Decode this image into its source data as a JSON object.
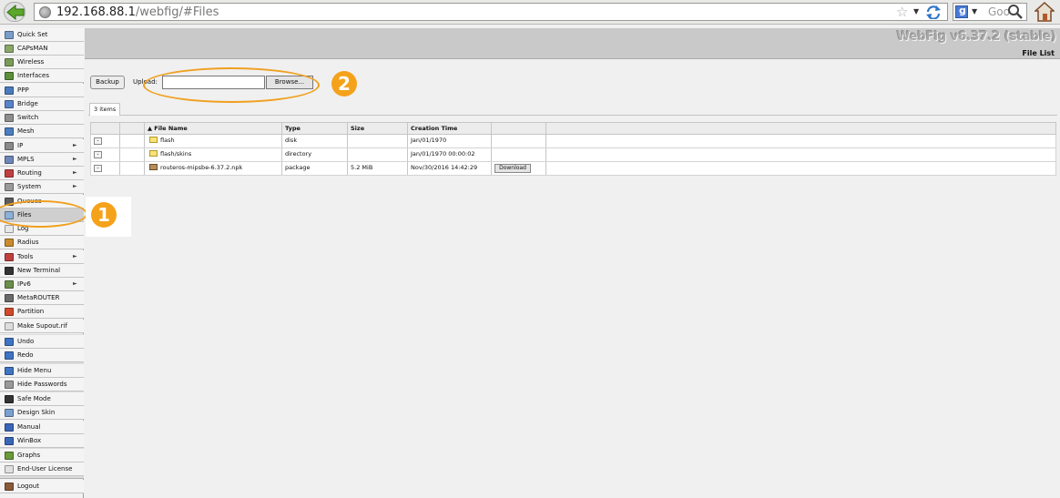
{
  "browser": {
    "url_host": "192.168.88.1",
    "url_path": "/webfig/#Files",
    "search_placeholder": "Goo"
  },
  "header": {
    "brand": "WebFig v6.37.2 (stable)",
    "page_title": "File List"
  },
  "sidebar": {
    "items": [
      {
        "label": "Quick Set",
        "icon": "quick-set-icon",
        "color": "#7a9ec9"
      },
      {
        "label": "CAPsMAN",
        "icon": "capsman-icon",
        "color": "#8aa76a"
      },
      {
        "label": "Wireless",
        "icon": "wireless-icon",
        "color": "#7a9b58"
      },
      {
        "label": "Interfaces",
        "icon": "interfaces-icon",
        "color": "#5b8f3a"
      },
      {
        "label": "PPP",
        "icon": "ppp-icon",
        "color": "#4a7bbd"
      },
      {
        "label": "Bridge",
        "icon": "bridge-icon",
        "color": "#5a83c8"
      },
      {
        "label": "Switch",
        "icon": "switch-icon",
        "color": "#8e8e8e"
      },
      {
        "label": "Mesh",
        "icon": "mesh-icon",
        "color": "#4b7dc0"
      },
      {
        "label": "IP",
        "icon": "ip-icon",
        "color": "#8a8a8a"
      },
      {
        "label": "MPLS",
        "icon": "mpls-icon",
        "color": "#6f86b8"
      },
      {
        "label": "Routing",
        "icon": "routing-icon",
        "color": "#c04040"
      },
      {
        "label": "System",
        "icon": "system-icon",
        "color": "#9a9a9a"
      },
      {
        "label": "Queues",
        "icon": "queues-icon",
        "color": "#5c5c5c"
      },
      {
        "label": "Files",
        "icon": "files-folder-icon",
        "color": "#8db0d6"
      },
      {
        "label": "Log",
        "icon": "log-icon",
        "color": "#e8e8e8"
      },
      {
        "label": "Radius",
        "icon": "radius-icon",
        "color": "#c98a30"
      },
      {
        "label": "Tools",
        "icon": "tools-icon",
        "color": "#c04040"
      },
      {
        "label": "New Terminal",
        "icon": "terminal-icon",
        "color": "#333333"
      },
      {
        "label": "IPv6",
        "icon": "ipv6-icon",
        "color": "#6a8f4a"
      },
      {
        "label": "MetaROUTER",
        "icon": "metarouter-icon",
        "color": "#6a6a6a"
      },
      {
        "label": "Partition",
        "icon": "partition-icon",
        "color": "#d04a2a"
      },
      {
        "label": "Make Supout.rif",
        "icon": "supout-icon",
        "color": "#dddddd"
      },
      {
        "label": "Undo",
        "icon": "undo-icon",
        "color": "#3f74c4"
      },
      {
        "label": "Redo",
        "icon": "redo-icon",
        "color": "#3f74c4"
      },
      {
        "label": "Hide Menu",
        "icon": "hide-menu-icon",
        "color": "#3f74c4"
      },
      {
        "label": "Hide Passwords",
        "icon": "hide-passwords-icon",
        "color": "#9a9a9a"
      },
      {
        "label": "Safe Mode",
        "icon": "umbrella-icon",
        "color": "#333333"
      },
      {
        "label": "Design Skin",
        "icon": "design-skin-icon",
        "color": "#7aa0cf"
      },
      {
        "label": "Manual",
        "icon": "manual-icon",
        "color": "#3a66b8"
      },
      {
        "label": "WinBox",
        "icon": "winbox-icon",
        "color": "#3a66b8"
      },
      {
        "label": "Graphs",
        "icon": "graphs-icon",
        "color": "#6a9a3a"
      },
      {
        "label": "End-User License",
        "icon": "license-icon",
        "color": "#e0e0e0"
      },
      {
        "label": "Logout",
        "icon": "logout-icon",
        "color": "#8a5a3a"
      }
    ]
  },
  "actions": {
    "backup_label": "Backup",
    "upload_label": "Upload:",
    "browse_label": "Browse..."
  },
  "items_tab": "3 items",
  "table": {
    "sort_marker": "▲",
    "columns": [
      "File Name",
      "Type",
      "Size",
      "Creation Time"
    ],
    "rows": [
      {
        "name": "flash",
        "type": "disk",
        "size": "",
        "created": "Jan/01/1970",
        "action": ""
      },
      {
        "name": "flash/skins",
        "type": "directory",
        "size": "",
        "created": "Jan/01/1970 00:00:02",
        "action": ""
      },
      {
        "name": "routeros-mipsbe-6.37.2.npk",
        "type": "package",
        "size": "5.2 MiB",
        "created": "Nov/30/2016 14:42:29",
        "action": "Download"
      }
    ]
  },
  "annotations": {
    "badge_1": "1",
    "badge_2": "2",
    "accent": "#f5a21b"
  }
}
